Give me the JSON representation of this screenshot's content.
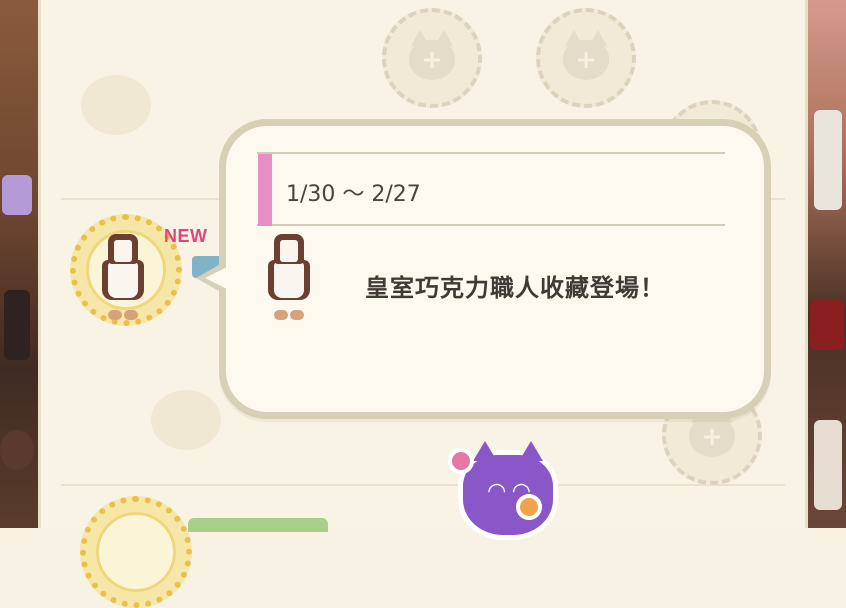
{
  "event_popup": {
    "date_range": "1/30 ～ 2/27",
    "message": "皇室巧克力職人收藏登場！",
    "item_icon": "maid-dress-icon"
  },
  "list": {
    "new_label": "NEW",
    "empty_slot_icon": "cat-silhouette-plus-icon",
    "sticker_icon": "purple-cat-sticker-icon"
  },
  "colors": {
    "accent_pink": "#e68fc4",
    "bubble_border": "#d8cfb7",
    "new_label": "#e0457a",
    "badge_gold": "#e6c24a"
  }
}
